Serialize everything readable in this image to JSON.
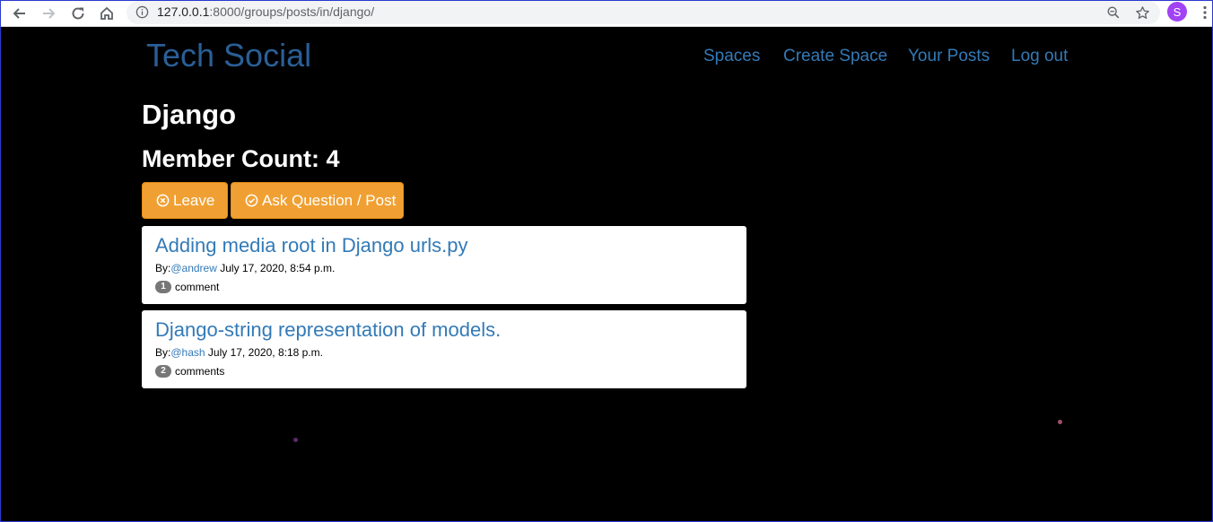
{
  "browser": {
    "url_host": "127.0.0.1",
    "url_path": ":8000/groups/posts/in/django/",
    "profile_initial": "S"
  },
  "site": {
    "brand": "Tech Social",
    "nav": [
      "Spaces",
      "Create Space",
      "Your Posts",
      "Log out"
    ]
  },
  "group": {
    "title": "Django",
    "member_count": "Member Count: 4",
    "leave_label": "Leave",
    "post_label": "Ask Question / Post"
  },
  "posts": [
    {
      "title": "Adding media root in Django urls.py",
      "by": "By:",
      "author": "@andrew",
      "date": "July 17, 2020, 8:54 p.m.",
      "comment_count": "1",
      "comment_label": "comment"
    },
    {
      "title": "Django-string representation of models.",
      "by": "By:",
      "author": "@hash",
      "date": "July 17, 2020, 8:18 p.m.",
      "comment_count": "2",
      "comment_label": "comments"
    }
  ],
  "colors": {
    "accent": "#337ab7",
    "button": "#f0a033",
    "background": "#000000"
  }
}
